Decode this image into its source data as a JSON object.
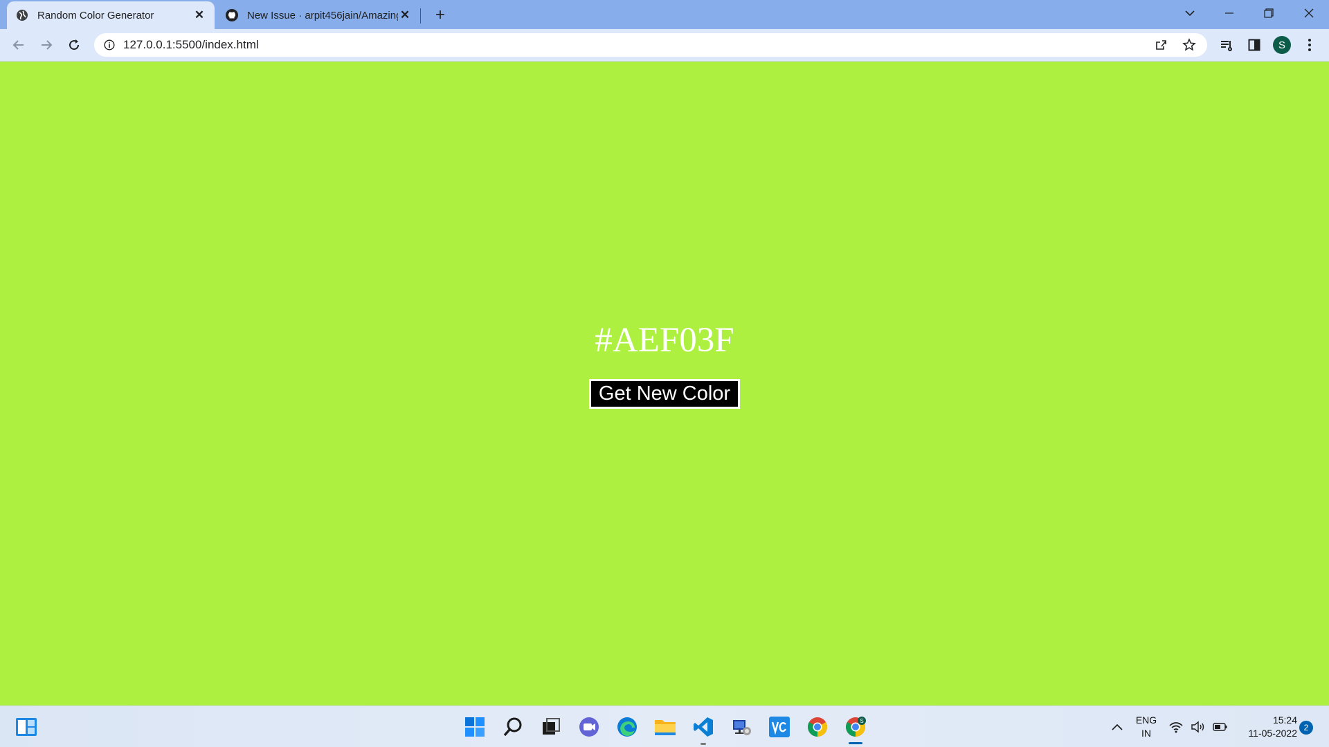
{
  "browser": {
    "tabs": [
      {
        "title": "Random Color Generator",
        "icon": "globe-icon"
      },
      {
        "title": "New Issue · arpit456jain/Amazing",
        "icon": "github-icon"
      }
    ],
    "address": "127.0.0.1:5500/index.html",
    "profile_initial": "S"
  },
  "page": {
    "color_hex": "#AEF03F",
    "button_label": "Get New Color",
    "background_color": "#AEF03F"
  },
  "taskbar": {
    "language_line1": "ENG",
    "language_line2": "IN",
    "time": "15:24",
    "date": "11-05-2022",
    "notification_count": "2",
    "apps": [
      "start-icon",
      "search-icon",
      "task-view-icon",
      "chat-icon",
      "edge-icon",
      "file-explorer-icon",
      "vscode-icon",
      "network-app-icon",
      "vc-app-icon",
      "chrome-icon",
      "chrome-profile-icon"
    ]
  }
}
